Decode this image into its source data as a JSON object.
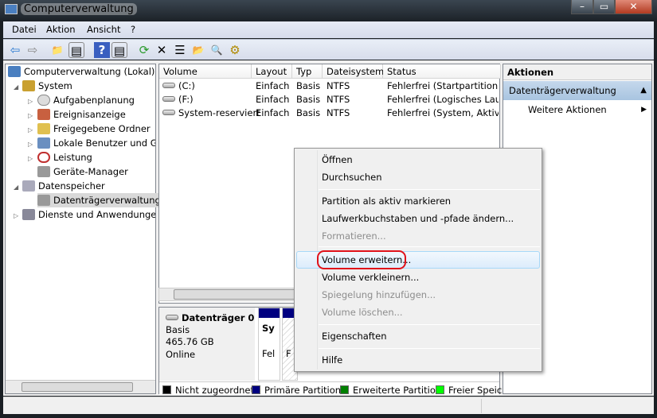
{
  "window": {
    "title": "Computerverwaltung",
    "minimize": "–",
    "maximize": "▭",
    "close": "✕"
  },
  "menubar": [
    "Datei",
    "Aktion",
    "Ansicht",
    "?"
  ],
  "toolbar": [
    {
      "icon": "back-arrow-icon",
      "glyph": "⇦"
    },
    {
      "icon": "forward-arrow-icon",
      "glyph": "⇨"
    },
    {
      "icon": "up-folder-icon",
      "glyph": "📁"
    },
    {
      "icon": "show-hide-tree-icon",
      "glyph": "▤"
    },
    {
      "icon": "help-icon",
      "glyph": "?"
    },
    {
      "icon": "show-hide-action-icon",
      "glyph": "▤"
    },
    {
      "icon": "refresh-icon",
      "glyph": "⟳"
    },
    {
      "icon": "delete-icon",
      "glyph": "✕"
    },
    {
      "icon": "properties-icon",
      "glyph": "☰"
    },
    {
      "icon": "open-folder-icon",
      "glyph": "📂"
    },
    {
      "icon": "search-icon",
      "glyph": "🔍"
    },
    {
      "icon": "settings-icon",
      "glyph": "⚙"
    }
  ],
  "tree": {
    "root": "Computerverwaltung (Lokal)",
    "system": "System",
    "system_children": [
      "Aufgabenplanung",
      "Ereignisanzeige",
      "Freigegebene Ordner",
      "Lokale Benutzer und Gruppen",
      "Leistung",
      "Geräte-Manager"
    ],
    "storage": "Datenspeicher",
    "storage_children": [
      "Datenträgerverwaltung"
    ],
    "services": "Dienste und Anwendungen"
  },
  "table": {
    "columns": [
      "Volume",
      "Layout",
      "Typ",
      "Dateisystem",
      "Status"
    ],
    "rows": [
      [
        "(C:)",
        "Einfach",
        "Basis",
        "NTFS",
        "Fehlerfrei (Startpartition, A"
      ],
      [
        "(F:)",
        "Einfach",
        "Basis",
        "NTFS",
        "Fehlerfrei (Logisches Laufw"
      ],
      [
        "System-reserviert",
        "Einfach",
        "Basis",
        "NTFS",
        "Fehlerfrei (System, Aktiv, P"
      ]
    ]
  },
  "disk": {
    "name": "Datenträger 0",
    "type": "Basis",
    "size": "465.76 GB",
    "state": "Online",
    "part1_label": "Sy",
    "part1_status": "Fel",
    "part2_status": "F"
  },
  "legend": [
    {
      "label": "Nicht zugeordnet",
      "color": "#000000"
    },
    {
      "label": "Primäre Partition",
      "color": "#000080"
    },
    {
      "label": "Erweiterte Partition",
      "color": "#008000"
    },
    {
      "label": "Freier Speic",
      "color": "#00ff00"
    }
  ],
  "actions": {
    "header": "Aktionen",
    "section": "Datenträgerverwaltung",
    "more": "Weitere Aktionen"
  },
  "context_menu": [
    {
      "label": "Öffnen",
      "enabled": true
    },
    {
      "label": "Durchsuchen",
      "enabled": true
    },
    {
      "label": "Partition als aktiv markieren",
      "enabled": true
    },
    {
      "label": "Laufwerkbuchstaben und -pfade ändern...",
      "enabled": true
    },
    {
      "label": "Formatieren...",
      "enabled": false
    },
    {
      "label": "Volume erweitern...",
      "enabled": true,
      "highlighted": true
    },
    {
      "label": "Volume verkleinern...",
      "enabled": true
    },
    {
      "label": "Spiegelung hinzufügen...",
      "enabled": false
    },
    {
      "label": "Volume löschen...",
      "enabled": false
    },
    {
      "label": "Eigenschaften",
      "enabled": true
    },
    {
      "label": "Hilfe",
      "enabled": true
    }
  ]
}
